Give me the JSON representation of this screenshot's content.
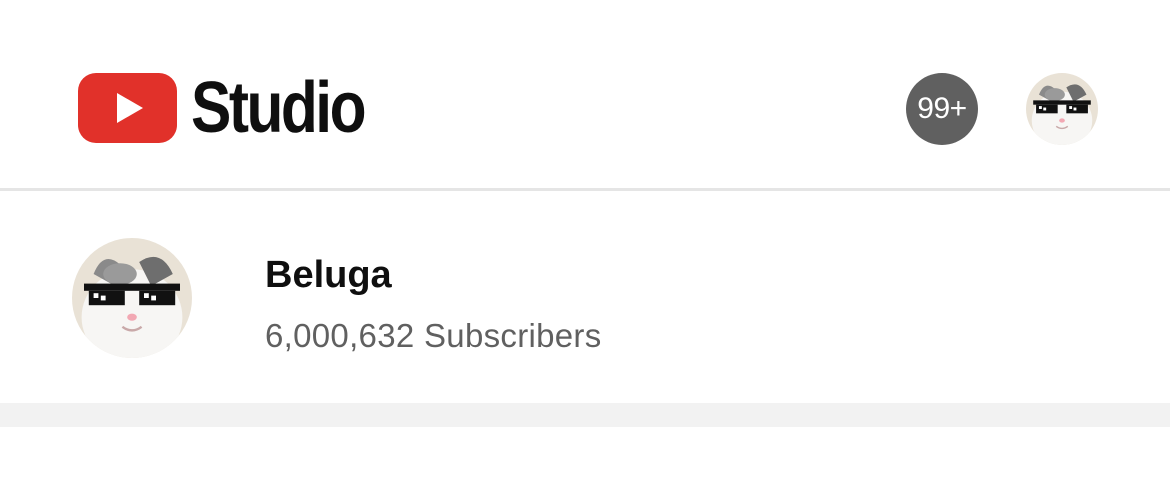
{
  "header": {
    "app_name": "Studio",
    "notifications": {
      "count_label": "99+"
    }
  },
  "channel": {
    "name": "Beluga",
    "subscribers": "6,000,632 Subscribers"
  },
  "icons": {
    "logo": "youtube-play-icon",
    "account": "avatar-cat-sunglasses"
  },
  "colors": {
    "brand_red": "#ff0000",
    "badge_bg": "#606060",
    "divider": "#e5e5e5",
    "section_band": "#f2f2f2",
    "secondary_text": "#606060"
  }
}
